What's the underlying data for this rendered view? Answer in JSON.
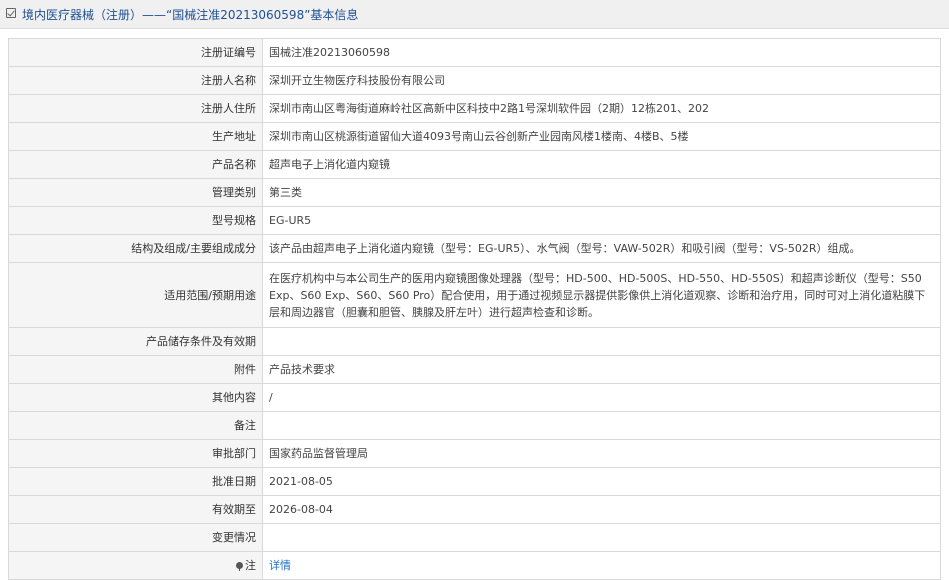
{
  "header": {
    "title": "境内医疗器械（注册）——“国械注准20213060598”基本信息"
  },
  "rows": [
    {
      "label": "注册证编号",
      "value": "国械注准20213060598"
    },
    {
      "label": "注册人名称",
      "value": "深圳开立生物医疗科技股份有限公司"
    },
    {
      "label": "注册人住所",
      "value": "深圳市南山区粤海街道麻岭社区高新中区科技中2路1号深圳软件园（2期）12栋201、202"
    },
    {
      "label": "生产地址",
      "value": "深圳市南山区桃源街道留仙大道4093号南山云谷创新产业园南风楼1楼南、4楼B、5楼"
    },
    {
      "label": "产品名称",
      "value": "超声电子上消化道内窥镜"
    },
    {
      "label": "管理类别",
      "value": "第三类"
    },
    {
      "label": "型号规格",
      "value": "EG-UR5"
    },
    {
      "label": "结构及组成/主要组成成分",
      "value": "该产品由超声电子上消化道内窥镜（型号：EG-UR5）、水气阀（型号：VAW-502R）和吸引阀（型号：VS-502R）组成。"
    },
    {
      "label": "适用范围/预期用途",
      "value": "在医疗机构中与本公司生产的医用内窥镜图像处理器（型号：HD-500、HD-500S、HD-550、HD-550S）和超声诊断仪（型号：S50 Exp、S60 Exp、S60、S60 Pro）配合使用，用于通过视频显示器提供影像供上消化道观察、诊断和治疗用，同时可对上消化道粘膜下层和周边器官（胆囊和胆管、胰腺及肝左叶）进行超声检查和诊断。"
    },
    {
      "label": "产品储存条件及有效期",
      "value": ""
    },
    {
      "label": "附件",
      "value": "产品技术要求"
    },
    {
      "label": "其他内容",
      "value": "/"
    },
    {
      "label": "备注",
      "value": ""
    },
    {
      "label": "审批部门",
      "value": "国家药品监督管理局"
    },
    {
      "label": "批准日期",
      "value": "2021-08-05"
    },
    {
      "label": "有效期至",
      "value": "2026-08-04"
    },
    {
      "label": "变更情况",
      "value": ""
    }
  ],
  "note": {
    "label": "注",
    "link": "详情",
    "icon": "pin-icon"
  }
}
